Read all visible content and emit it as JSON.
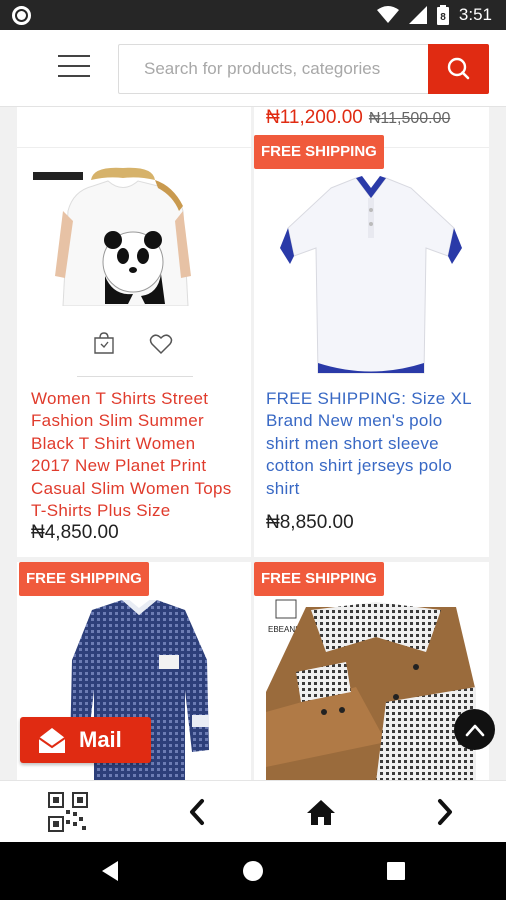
{
  "status_bar": {
    "time": "3:51",
    "battery_level": "8"
  },
  "search": {
    "placeholder": "Search for products, categories"
  },
  "products": [
    {
      "price": "₦11,200.00",
      "old_price": "₦11,500.00"
    },
    {
      "title": "Women T Shirts Street Fashion Slim Summer Black T Shirt Women 2017 New Planet Print Casual Slim Women Tops T-Shirts Plus Size",
      "price": "₦4,850.00",
      "image_label": "Panda print white t-shirt"
    },
    {
      "badge": "FREE SHIPPING",
      "title": "FREE SHIPPING: Size XL Brand New men's polo shirt men short sleeve cotton shirt jerseys polo shirt",
      "price": "₦8,850.00",
      "image_label": "White polo shirt with blue trim"
    },
    {
      "badge": "FREE SHIPPING",
      "image_label": "Blue checkered long sleeve shirt"
    },
    {
      "badge": "FREE SHIPPING",
      "image_label": "Brown and checkered long sleeve shirt",
      "brand_text": "EBEANIS"
    }
  ],
  "mail": {
    "label": "Mail"
  },
  "colors": {
    "accent": "#e02b12",
    "badge": "#f05a3c",
    "link_blue": "#3868c4",
    "title_red": "#e03b2c"
  }
}
